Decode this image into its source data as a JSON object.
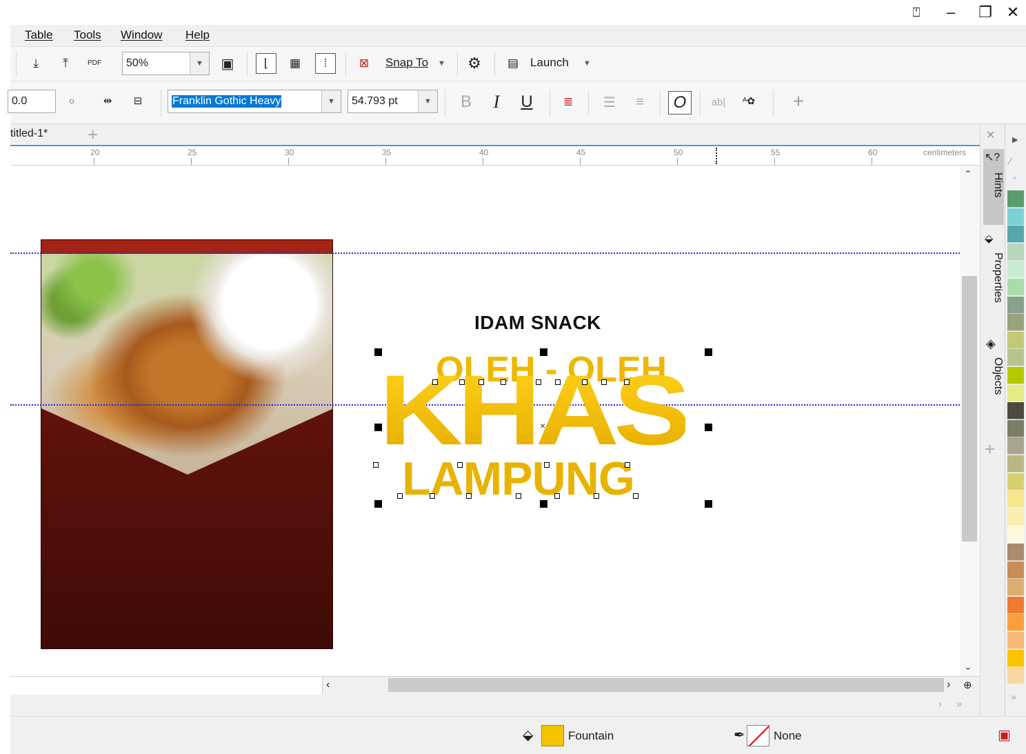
{
  "window_controls": {
    "minimize": "‒",
    "restore": "❐",
    "close": "✕"
  },
  "menu": {
    "items": [
      "Table",
      "Tools",
      "Window",
      "Help"
    ]
  },
  "toolbar1": {
    "zoom_value": "50%",
    "snap_label": "Snap To",
    "launch_label": "Launch",
    "pdf_label": "PDF"
  },
  "toolbar2": {
    "coord_value": "0.0",
    "font_name": "Franklin Gothic Heavy",
    "font_size": "54.793 pt",
    "bold": "B",
    "italic": "I",
    "underline": "U",
    "add": "+"
  },
  "document": {
    "tab_title": "titled-1*",
    "add_tab": "+"
  },
  "ruler": {
    "ticks": [
      "20",
      "25",
      "30",
      "35",
      "40",
      "45",
      "50",
      "55",
      "60"
    ],
    "unit": "centimeters"
  },
  "artwork": {
    "heading": "IDAM SNACK",
    "line1": "OLEH - OLEH",
    "line2": "KHAS",
    "line3": "LAMPUNG"
  },
  "dockers": {
    "tabs": [
      "Hints",
      "Properties",
      "Objects"
    ],
    "close": "✕",
    "add": "+"
  },
  "status": {
    "fill_label": "Fountain",
    "outline_label": "None",
    "fill_color": "#f5c400"
  },
  "palette": {
    "colors": [
      "#5c9c6c",
      "#7fd0d4",
      "#58a6ad",
      "#b9d6c0",
      "#c8ead0",
      "#a8dcaa",
      "#8aa08e",
      "#9aa27e",
      "#c2c87a",
      "#b5c48e",
      "#b6c800",
      "#e4ec88",
      "#4a4a40",
      "#7c7c6a",
      "#a8a690",
      "#b8b880",
      "#d8d070",
      "#f8e68c",
      "#fbeeb0",
      "#fff8dc",
      "#a88c6c",
      "#c88c58",
      "#d8b070",
      "#f07a30",
      "#f8a040",
      "#f8b878",
      "#f8c400",
      "#f8d8a0"
    ]
  }
}
